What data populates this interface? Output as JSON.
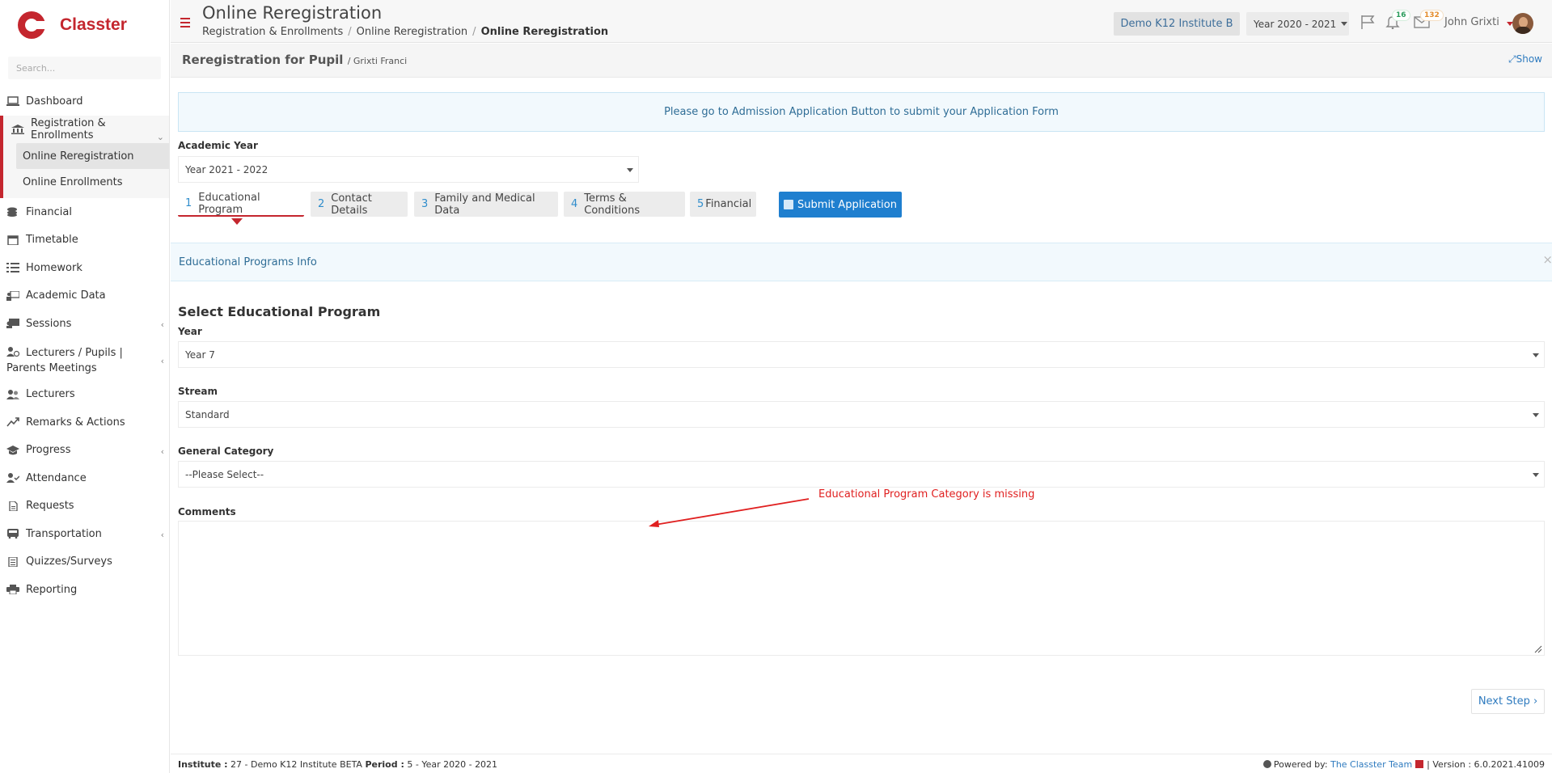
{
  "app": {
    "name": "Classter"
  },
  "sidebar": {
    "search_placeholder": "Search...",
    "items": [
      {
        "label": "Dashboard",
        "icon": "laptop-icon"
      },
      {
        "label": "Registration & Enrollments",
        "icon": "bank-icon"
      },
      {
        "label": "Financial",
        "icon": "coins-icon"
      },
      {
        "label": "Timetable",
        "icon": "calendar-icon"
      },
      {
        "label": "Homework",
        "icon": "tasks-icon"
      },
      {
        "label": "Academic Data",
        "icon": "teacher-board-icon"
      },
      {
        "label": "Sessions",
        "icon": "sessions-icon"
      },
      {
        "label": "Lecturers / Pupils | Parents Meetings",
        "icon": "user-clock-icon"
      },
      {
        "label": "Lecturers",
        "icon": "users-icon"
      },
      {
        "label": "Remarks & Actions",
        "icon": "remarks-icon"
      },
      {
        "label": "Progress",
        "icon": "graduation-cap-icon"
      },
      {
        "label": "Attendance",
        "icon": "user-check-icon"
      },
      {
        "label": "Requests",
        "icon": "file-icon"
      },
      {
        "label": "Transportation",
        "icon": "bus-icon"
      },
      {
        "label": "Quizzes/Surveys",
        "icon": "checklist-icon"
      },
      {
        "label": "Reporting",
        "icon": "printer-icon"
      }
    ],
    "sub_items": [
      "Online Reregistration",
      "Online Enrollments"
    ]
  },
  "header": {
    "title": "Online Reregistration",
    "breadcrumb": [
      "Registration & Enrollments",
      "Online Reregistration",
      "Online Reregistration"
    ],
    "institute": "Demo K12 Institute B",
    "year": "Year 2020 - 2021",
    "notifications_count": "16",
    "messages_count": "132",
    "user_name": "John Grixti"
  },
  "page": {
    "title": "Reregistration for Pupil",
    "subtitle": "/ Grixti Franci",
    "show_label": "Show",
    "alert": "Please go to Admission Application Button to submit your Application Form",
    "academic_year_label": "Academic Year",
    "academic_year_value": "Year 2021 - 2022",
    "tabs": [
      {
        "num": "1",
        "label": "Educational Program"
      },
      {
        "num": "2",
        "label": "Contact Details"
      },
      {
        "num": "3",
        "label": "Family and Medical Data"
      },
      {
        "num": "4",
        "label": "Terms & Conditions"
      },
      {
        "num": "5",
        "label": "Financial"
      }
    ],
    "submit_label": "Submit Application",
    "section_title": "Educational Programs Info",
    "form_title": "Select Educational Program",
    "year_label": "Year",
    "year_value": "Year 7",
    "stream_label": "Stream",
    "stream_value": "Standard",
    "category_label": "General Category",
    "category_value": "--Please Select--",
    "comments_label": "Comments",
    "next_label": "Next Step",
    "annotation": "Educational Program Category is missing"
  },
  "footer": {
    "institute_label": "Institute :",
    "institute_value": "27 - Demo K12 Institute BETA",
    "period_label": "Period :",
    "period_value": "5 - Year 2020 - 2021",
    "powered_by": "Powered by:",
    "team": "The Classter Team",
    "version": "| Version : 6.0.2021.41009"
  },
  "colors": {
    "brand_red": "#c4262e",
    "primary_blue": "#1f7fcf",
    "info_text": "#2f6d96",
    "annotation_red": "#e02020"
  }
}
